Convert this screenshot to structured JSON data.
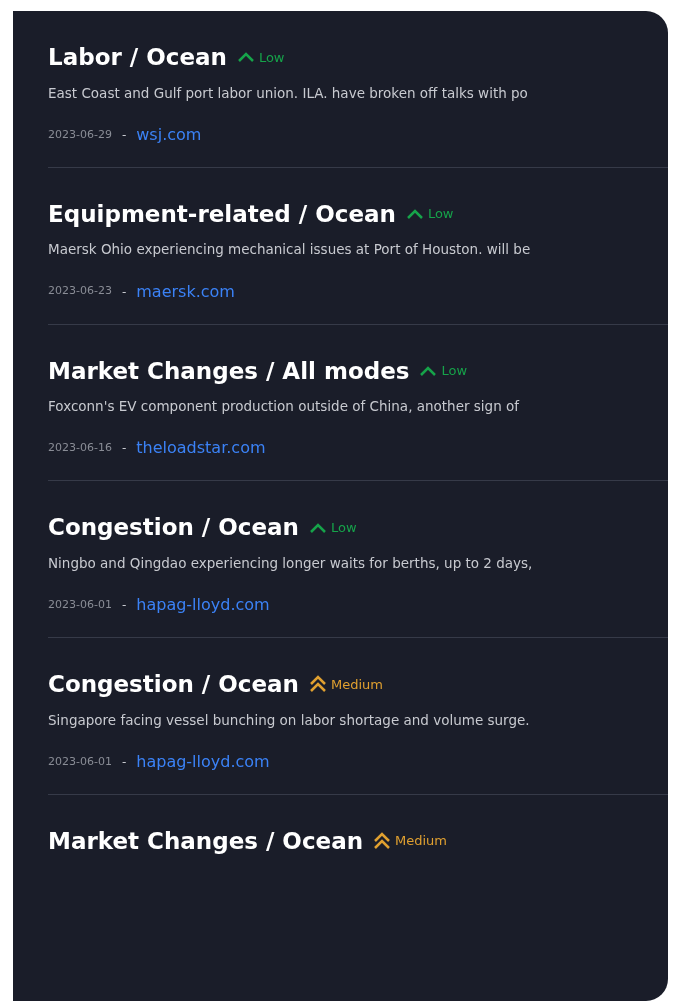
{
  "alerts": [
    {
      "title": "Labor / Ocean",
      "severity": {
        "kind": "low",
        "label": "Low"
      },
      "description": "East Coast and Gulf port labor union. ILA. have broken off talks with po",
      "date": "2023-06-29",
      "separator": "-",
      "source": "wsj.com"
    },
    {
      "title": "Equipment-related / Ocean",
      "severity": {
        "kind": "low",
        "label": "Low"
      },
      "description": "Maersk Ohio experiencing mechanical issues at Port of Houston. will be",
      "date": "2023-06-23",
      "separator": "-",
      "source": "maersk.com"
    },
    {
      "title": "Market Changes / All modes",
      "severity": {
        "kind": "low",
        "label": "Low"
      },
      "description": "Foxconn's EV component production outside of China, another sign of",
      "date": "2023-06-16",
      "separator": "-",
      "source": "theloadstar.com"
    },
    {
      "title": "Congestion / Ocean",
      "severity": {
        "kind": "low",
        "label": "Low"
      },
      "description": "Ningbo and Qingdao experiencing longer waits for berths, up to 2 days,",
      "date": "2023-06-01",
      "separator": "-",
      "source": "hapag-lloyd.com"
    },
    {
      "title": "Congestion / Ocean",
      "severity": {
        "kind": "medium",
        "label": "Medium"
      },
      "description": "Singapore facing vessel bunching on labor shortage and volume surge.",
      "date": "2023-06-01",
      "separator": "-",
      "source": "hapag-lloyd.com"
    },
    {
      "title": "Market Changes / Ocean",
      "severity": {
        "kind": "medium",
        "label": "Medium"
      }
    }
  ]
}
